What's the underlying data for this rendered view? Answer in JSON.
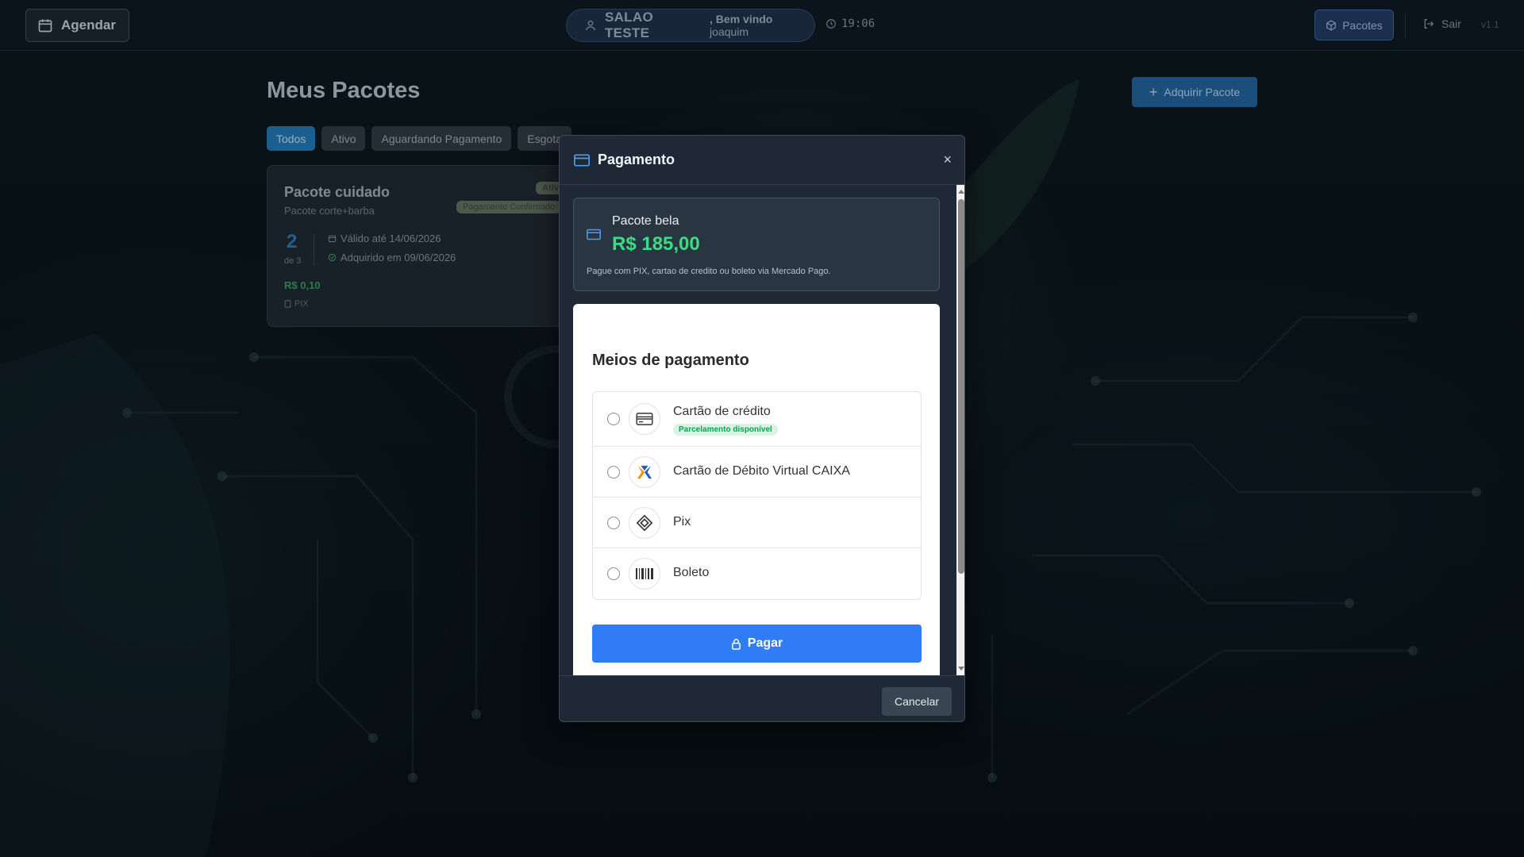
{
  "topbar": {
    "agendar_label": "Agendar",
    "salon_name": "SALAO TESTE",
    "welcome_prefix": ", Bem vindo",
    "user_name": "joaquim",
    "clock": "19:06",
    "pacotes_label": "Pacotes",
    "sair_label": "Sair",
    "version": "v1.1"
  },
  "page": {
    "title": "Meus Pacotes",
    "adquirir_label": "Adquirir Pacote",
    "tabs": [
      {
        "label": "Todos",
        "active": true
      },
      {
        "label": "Ativo"
      },
      {
        "label": "Aguardando Pagamento"
      },
      {
        "label": "Esgota"
      }
    ]
  },
  "package_card": {
    "name": "Pacote cuidado",
    "subtitle": "Pacote corte+barba",
    "status_badge": "Ativo",
    "payment_badge": "Pagamento Confirmado",
    "used": "2",
    "of_total": "de 3",
    "valid_until": "Válido até 14/06/2026",
    "acquired_on": "Adquirido em 09/06/2026",
    "price": "R$ 0,10",
    "method": "PIX"
  },
  "modal": {
    "title": "Pagamento",
    "close_symbol": "×",
    "summary": {
      "package_name": "Pacote bela",
      "price": "R$ 185,00",
      "description": "Pague com PIX, cartao de credito ou boleto via Mercado Pago."
    },
    "payment_methods_title": "Meios de pagamento",
    "methods": [
      {
        "label": "Cartão de crédito",
        "tag": "Parcelamento disponível",
        "icon": "credit-card-icon"
      },
      {
        "label": "Cartão de Débito Virtual CAIXA",
        "icon": "caixa-icon"
      },
      {
        "label": "Pix",
        "icon": "pix-icon"
      },
      {
        "label": "Boleto",
        "icon": "barcode-icon"
      }
    ],
    "pay_label": "Pagar",
    "cancel_label": "Cancelar"
  },
  "colors": {
    "accent": "#2f7cf6",
    "price_green": "#3ddc84",
    "tag_green": "#00a650"
  }
}
